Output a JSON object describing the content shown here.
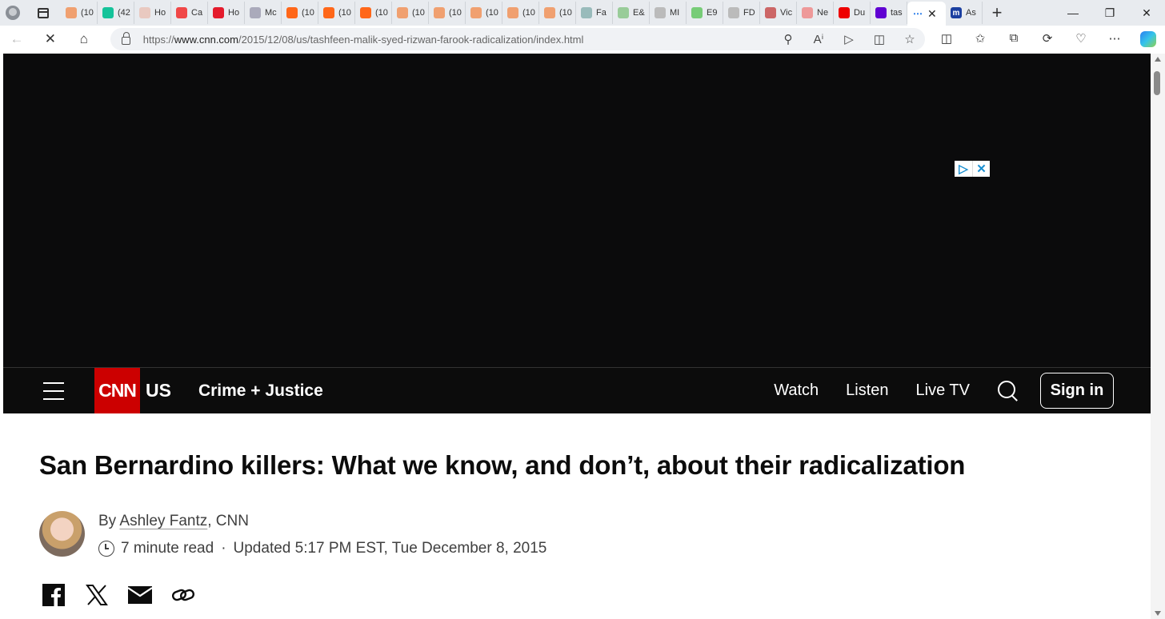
{
  "browser": {
    "tabs": [
      {
        "label": "(10",
        "icon": "substack-icon",
        "color": "#f0a070"
      },
      {
        "label": "(42",
        "icon": "grammarly-icon",
        "color": "#15c39a"
      },
      {
        "label": "Ho",
        "icon": "bi-icon",
        "color": "#e9c9c0"
      },
      {
        "label": "Ca",
        "icon": "youtube-icon",
        "color": "#f04747"
      },
      {
        "label": "Ho",
        "icon": "pocket-icon",
        "color": "#e41b2c"
      },
      {
        "label": "Mc",
        "icon": "ai-icon",
        "color": "#aab"
      },
      {
        "label": "(10",
        "icon": "substack-icon",
        "color": "#ff6719"
      },
      {
        "label": "(10",
        "icon": "substack-icon",
        "color": "#ff6719"
      },
      {
        "label": "(10",
        "icon": "substack-icon",
        "color": "#ff6719"
      },
      {
        "label": "(10",
        "icon": "substack-icon",
        "color": "#f0a070"
      },
      {
        "label": "(10",
        "icon": "substack-icon",
        "color": "#f0a070"
      },
      {
        "label": "(10",
        "icon": "substack-icon",
        "color": "#f0a070"
      },
      {
        "label": "(10",
        "icon": "substack-icon",
        "color": "#f0a070"
      },
      {
        "label": "(10",
        "icon": "substack-icon",
        "color": "#f0a070"
      },
      {
        "label": "Fa",
        "icon": "graph-icon",
        "color": "#9bb"
      },
      {
        "label": "E&",
        "icon": "power-icon",
        "color": "#9c9"
      },
      {
        "label": "MI",
        "icon": "page-icon",
        "color": "#bbb"
      },
      {
        "label": "E9",
        "icon": "play-icon",
        "color": "#7c7"
      },
      {
        "label": "FD",
        "icon": "page-icon",
        "color": "#bbb"
      },
      {
        "label": "Vic",
        "icon": "star-icon",
        "color": "#c66"
      },
      {
        "label": "Ne",
        "icon": "news-icon",
        "color": "#e99"
      },
      {
        "label": "Du",
        "icon": "youtube-icon",
        "color": "#e00"
      },
      {
        "label": "tas",
        "icon": "yahoo-icon",
        "color": "#6001d2"
      }
    ],
    "active_tab": {
      "icon": "loading-icon"
    },
    "last_tab": {
      "label": "As",
      "icon": "m-icon",
      "color": "#1b3fa0"
    },
    "url_prefix": "https://",
    "url_domain": "www.cnn.com",
    "url_path": "/2015/12/08/us/tashfeen-malik-syed-rizwan-farook-radicalization/index.html"
  },
  "nav": {
    "logo": "CNN",
    "section": "US",
    "subsection": "Crime + Justice",
    "links": [
      "Watch",
      "Listen",
      "Live TV"
    ],
    "signin": "Sign in"
  },
  "article": {
    "headline": "San Bernardino killers: What we know, and don’t, about their radicalization",
    "by": "By",
    "author": "Ashley Fantz",
    "source": ", CNN",
    "read_time": "7 minute read",
    "separator": "·",
    "updated": "Updated 5:17 PM EST, Tue December 8, 2015"
  }
}
